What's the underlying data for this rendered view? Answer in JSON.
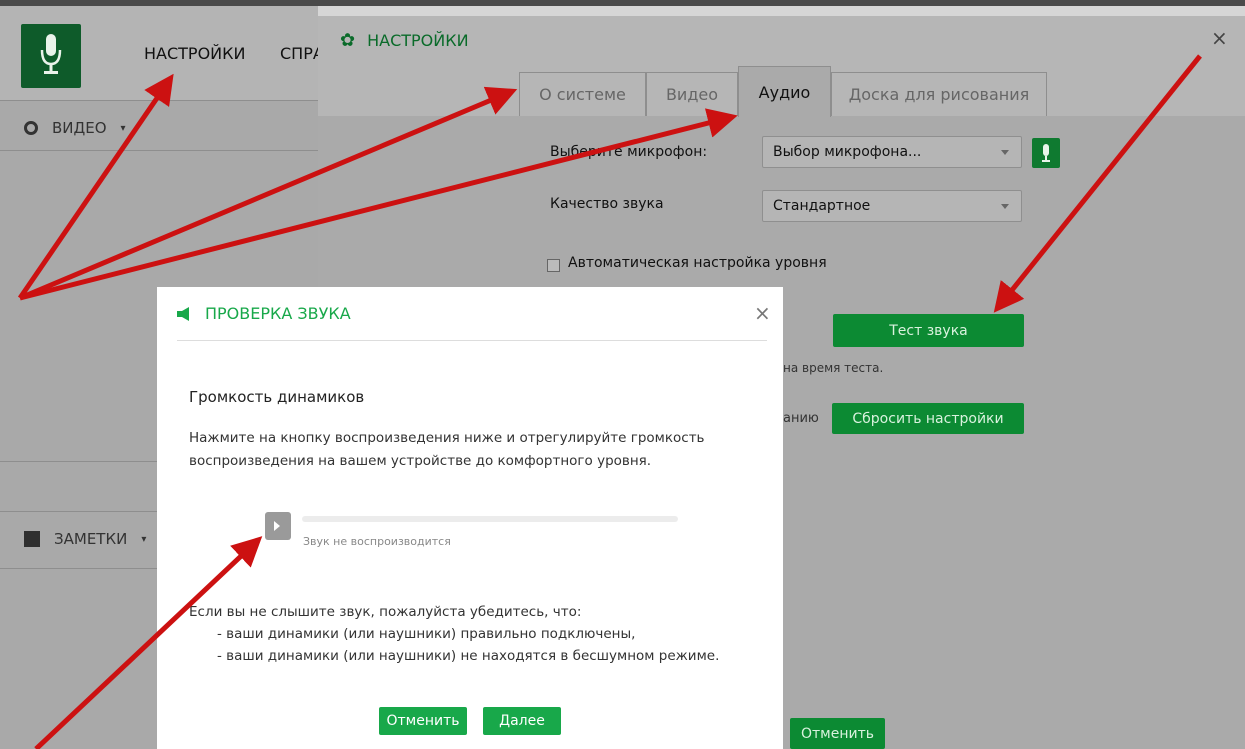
{
  "app": {
    "menu_settings": "НАСТРОЙКИ",
    "menu_help": "СПРА",
    "section_video": "ВИДЕО",
    "section_notes": "ЗАМЕТКИ"
  },
  "settings": {
    "title": "НАСТРОЙКИ",
    "close": "×",
    "tabs": [
      "О системе",
      "Видео",
      "Аудио",
      "Доска для рисования"
    ],
    "active_tab": "Аудио",
    "mic_label": "Выберите микрофон:",
    "mic_value": "Выбор микрофона...",
    "quality_label": "Качество звука",
    "quality_value": "Стандартное",
    "auto_level_label": "Автоматическая настройка уровня",
    "test_button": "Тест звука",
    "partial_note": "на время теста.",
    "partial_reset_label": "анию",
    "reset_button": "Сбросить настройки",
    "cancel_button": "Отменить"
  },
  "modal": {
    "title": "ПРОВЕРКА ЗВУКА",
    "close": "×",
    "heading": "Громкость динамиков",
    "instruction_line1": "Нажмите на кнопку воспроизведения ниже и отрегулируйте громкость",
    "instruction_line2": "воспроизведения на вашем устройстве до комфортного уровня.",
    "playback_status": "Звук не воспроизводится",
    "playback_progress": 0,
    "hint_intro": "Если вы не слышите звук, пожалуйста убедитесь, что:",
    "hint_item1": "- ваши динамики (или наушники) правильно подключены,",
    "hint_item2": "- ваши динамики (или наушники) не находятся в бесшумном режиме.",
    "cancel_button": "Отменить",
    "next_button": "Далее"
  },
  "colors": {
    "accent_green": "#18a84a",
    "dark_green": "#0c8a33",
    "arrow_red": "#cc1111"
  }
}
